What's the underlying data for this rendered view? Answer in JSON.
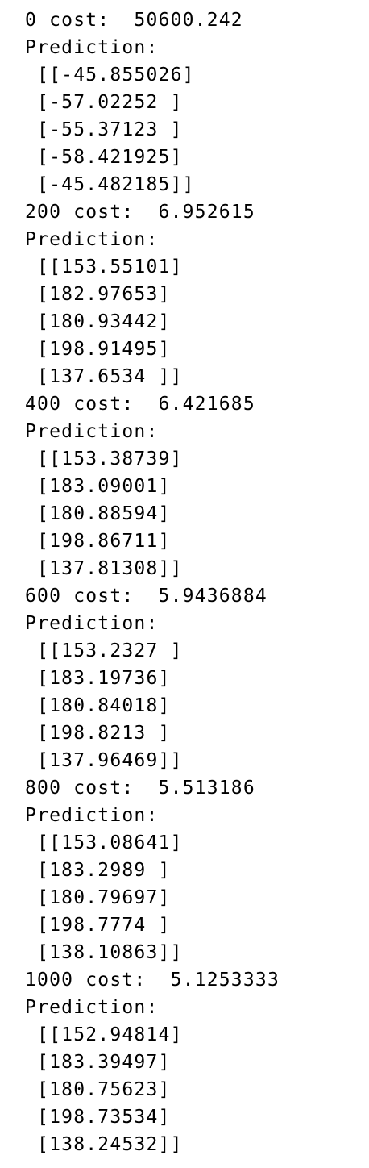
{
  "output": {
    "lines": [
      "0 cost:  50600.242",
      "Prediction:",
      " [[-45.855026]",
      " [-57.02252 ]",
      " [-55.37123 ]",
      " [-58.421925]",
      " [-45.482185]]",
      "200 cost:  6.952615",
      "Prediction:",
      " [[153.55101]",
      " [182.97653]",
      " [180.93442]",
      " [198.91495]",
      " [137.6534 ]]",
      "400 cost:  6.421685",
      "Prediction:",
      " [[153.38739]",
      " [183.09001]",
      " [180.88594]",
      " [198.86711]",
      " [137.81308]]",
      "600 cost:  5.9436884",
      "Prediction:",
      " [[153.2327 ]",
      " [183.19736]",
      " [180.84018]",
      " [198.8213 ]",
      " [137.96469]]",
      "800 cost:  5.513186",
      "Prediction:",
      " [[153.08641]",
      " [183.2989 ]",
      " [180.79697]",
      " [198.7774 ]",
      " [138.10863]]",
      "1000 cost:  5.1253333",
      "Prediction:",
      " [[152.94814]",
      " [183.39497]",
      " [180.75623]",
      " [198.73534]",
      " [138.24532]]"
    ]
  }
}
